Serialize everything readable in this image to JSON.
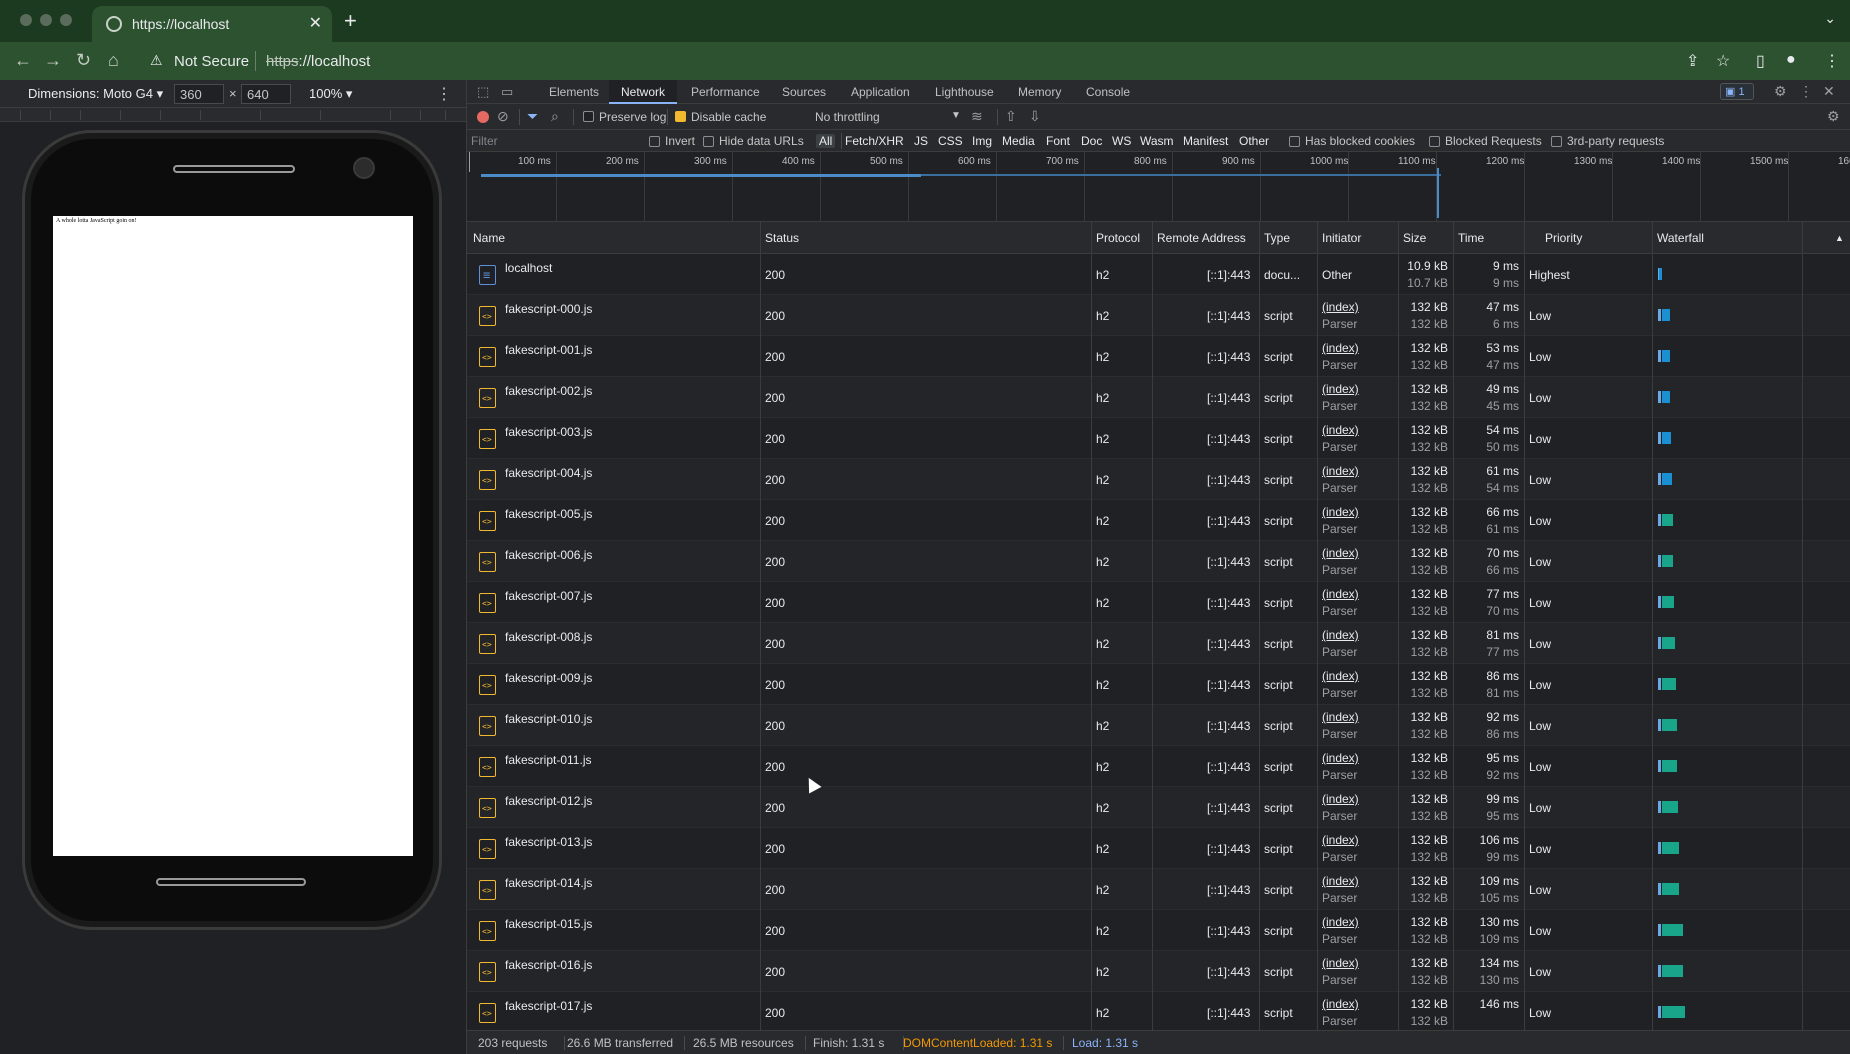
{
  "browser": {
    "tab_title": "https://localhost",
    "security_label": "Not Secure",
    "url_scheme": "https",
    "url_rest": "://localhost"
  },
  "device": {
    "dimensions_label": "Dimensions: Moto G4 ▾",
    "width": "360",
    "height": "640",
    "zoom": "100% ▾",
    "page_text": "A whole lotta JavaScript goin on!"
  },
  "devtools": {
    "tabs": [
      "Elements",
      "Network",
      "Performance",
      "Sources",
      "Application",
      "Lighthouse",
      "Memory",
      "Console"
    ],
    "active_tab": "Network",
    "issues_badge": "1"
  },
  "network_toolbar": {
    "preserve_log": "Preserve log",
    "disable_cache": "Disable cache",
    "throttling": "No throttling"
  },
  "filter_bar": {
    "placeholder": "Filter",
    "invert": "Invert",
    "hide_data_urls": "Hide data URLs",
    "types": [
      "All",
      "Fetch/XHR",
      "JS",
      "CSS",
      "Img",
      "Media",
      "Font",
      "Doc",
      "WS",
      "Wasm",
      "Manifest",
      "Other"
    ],
    "has_blocked_cookies": "Has blocked cookies",
    "blocked_requests": "Blocked Requests",
    "third_party": "3rd-party requests"
  },
  "timeline": {
    "ticks": [
      "100 ms",
      "200 ms",
      "300 ms",
      "400 ms",
      "500 ms",
      "600 ms",
      "700 ms",
      "800 ms",
      "900 ms",
      "1000 ms",
      "1100 ms",
      "1200 ms",
      "1300 ms",
      "1400 ms",
      "1500 ms",
      "160"
    ]
  },
  "columns": {
    "name": "Name",
    "status": "Status",
    "protocol": "Protocol",
    "remote": "Remote Address",
    "type": "Type",
    "initiator": "Initiator",
    "size": "Size",
    "time": "Time",
    "priority": "Priority",
    "waterfall": "Waterfall"
  },
  "requests": [
    {
      "name": "localhost",
      "status": "200",
      "protocol": "h2",
      "remote": "[::1]:443",
      "type": "docu...",
      "initiator": "Other",
      "initiator_sub": "",
      "size": "10.9 kB",
      "size_sub": "10.7 kB",
      "time": "9 ms",
      "time_sub": "9 ms",
      "priority": "Highest",
      "kind": "doc"
    },
    {
      "name": "fakescript-000.js",
      "status": "200",
      "protocol": "h2",
      "remote": "[::1]:443",
      "type": "script",
      "initiator": "(index)",
      "initiator_sub": "Parser",
      "size": "132 kB",
      "size_sub": "132 kB",
      "time": "47 ms",
      "time_sub": "6 ms",
      "priority": "Low",
      "kind": "js"
    },
    {
      "name": "fakescript-001.js",
      "status": "200",
      "protocol": "h2",
      "remote": "[::1]:443",
      "type": "script",
      "initiator": "(index)",
      "initiator_sub": "Parser",
      "size": "132 kB",
      "size_sub": "132 kB",
      "time": "53 ms",
      "time_sub": "47 ms",
      "priority": "Low",
      "kind": "js"
    },
    {
      "name": "fakescript-002.js",
      "status": "200",
      "protocol": "h2",
      "remote": "[::1]:443",
      "type": "script",
      "initiator": "(index)",
      "initiator_sub": "Parser",
      "size": "132 kB",
      "size_sub": "132 kB",
      "time": "49 ms",
      "time_sub": "45 ms",
      "priority": "Low",
      "kind": "js"
    },
    {
      "name": "fakescript-003.js",
      "status": "200",
      "protocol": "h2",
      "remote": "[::1]:443",
      "type": "script",
      "initiator": "(index)",
      "initiator_sub": "Parser",
      "size": "132 kB",
      "size_sub": "132 kB",
      "time": "54 ms",
      "time_sub": "50 ms",
      "priority": "Low",
      "kind": "js"
    },
    {
      "name": "fakescript-004.js",
      "status": "200",
      "protocol": "h2",
      "remote": "[::1]:443",
      "type": "script",
      "initiator": "(index)",
      "initiator_sub": "Parser",
      "size": "132 kB",
      "size_sub": "132 kB",
      "time": "61 ms",
      "time_sub": "54 ms",
      "priority": "Low",
      "kind": "js"
    },
    {
      "name": "fakescript-005.js",
      "status": "200",
      "protocol": "h2",
      "remote": "[::1]:443",
      "type": "script",
      "initiator": "(index)",
      "initiator_sub": "Parser",
      "size": "132 kB",
      "size_sub": "132 kB",
      "time": "66 ms",
      "time_sub": "61 ms",
      "priority": "Low",
      "kind": "js"
    },
    {
      "name": "fakescript-006.js",
      "status": "200",
      "protocol": "h2",
      "remote": "[::1]:443",
      "type": "script",
      "initiator": "(index)",
      "initiator_sub": "Parser",
      "size": "132 kB",
      "size_sub": "132 kB",
      "time": "70 ms",
      "time_sub": "66 ms",
      "priority": "Low",
      "kind": "js"
    },
    {
      "name": "fakescript-007.js",
      "status": "200",
      "protocol": "h2",
      "remote": "[::1]:443",
      "type": "script",
      "initiator": "(index)",
      "initiator_sub": "Parser",
      "size": "132 kB",
      "size_sub": "132 kB",
      "time": "77 ms",
      "time_sub": "70 ms",
      "priority": "Low",
      "kind": "js"
    },
    {
      "name": "fakescript-008.js",
      "status": "200",
      "protocol": "h2",
      "remote": "[::1]:443",
      "type": "script",
      "initiator": "(index)",
      "initiator_sub": "Parser",
      "size": "132 kB",
      "size_sub": "132 kB",
      "time": "81 ms",
      "time_sub": "77 ms",
      "priority": "Low",
      "kind": "js"
    },
    {
      "name": "fakescript-009.js",
      "status": "200",
      "protocol": "h2",
      "remote": "[::1]:443",
      "type": "script",
      "initiator": "(index)",
      "initiator_sub": "Parser",
      "size": "132 kB",
      "size_sub": "132 kB",
      "time": "86 ms",
      "time_sub": "81 ms",
      "priority": "Low",
      "kind": "js"
    },
    {
      "name": "fakescript-010.js",
      "status": "200",
      "protocol": "h2",
      "remote": "[::1]:443",
      "type": "script",
      "initiator": "(index)",
      "initiator_sub": "Parser",
      "size": "132 kB",
      "size_sub": "132 kB",
      "time": "92 ms",
      "time_sub": "86 ms",
      "priority": "Low",
      "kind": "js"
    },
    {
      "name": "fakescript-011.js",
      "status": "200",
      "protocol": "h2",
      "remote": "[::1]:443",
      "type": "script",
      "initiator": "(index)",
      "initiator_sub": "Parser",
      "size": "132 kB",
      "size_sub": "132 kB",
      "time": "95 ms",
      "time_sub": "92 ms",
      "priority": "Low",
      "kind": "js"
    },
    {
      "name": "fakescript-012.js",
      "status": "200",
      "protocol": "h2",
      "remote": "[::1]:443",
      "type": "script",
      "initiator": "(index)",
      "initiator_sub": "Parser",
      "size": "132 kB",
      "size_sub": "132 kB",
      "time": "99 ms",
      "time_sub": "95 ms",
      "priority": "Low",
      "kind": "js"
    },
    {
      "name": "fakescript-013.js",
      "status": "200",
      "protocol": "h2",
      "remote": "[::1]:443",
      "type": "script",
      "initiator": "(index)",
      "initiator_sub": "Parser",
      "size": "132 kB",
      "size_sub": "132 kB",
      "time": "106 ms",
      "time_sub": "99 ms",
      "priority": "Low",
      "kind": "js"
    },
    {
      "name": "fakescript-014.js",
      "status": "200",
      "protocol": "h2",
      "remote": "[::1]:443",
      "type": "script",
      "initiator": "(index)",
      "initiator_sub": "Parser",
      "size": "132 kB",
      "size_sub": "132 kB",
      "time": "109 ms",
      "time_sub": "105 ms",
      "priority": "Low",
      "kind": "js"
    },
    {
      "name": "fakescript-015.js",
      "status": "200",
      "protocol": "h2",
      "remote": "[::1]:443",
      "type": "script",
      "initiator": "(index)",
      "initiator_sub": "Parser",
      "size": "132 kB",
      "size_sub": "132 kB",
      "time": "130 ms",
      "time_sub": "109 ms",
      "priority": "Low",
      "kind": "js"
    },
    {
      "name": "fakescript-016.js",
      "status": "200",
      "protocol": "h2",
      "remote": "[::1]:443",
      "type": "script",
      "initiator": "(index)",
      "initiator_sub": "Parser",
      "size": "132 kB",
      "size_sub": "132 kB",
      "time": "134 ms",
      "time_sub": "130 ms",
      "priority": "Low",
      "kind": "js"
    },
    {
      "name": "fakescript-017.js",
      "status": "200",
      "protocol": "h2",
      "remote": "[::1]:443",
      "type": "script",
      "initiator": "(index)",
      "initiator_sub": "Parser",
      "size": "132 kB",
      "size_sub": "132 kB",
      "time": "146 ms",
      "time_sub": "",
      "priority": "Low",
      "kind": "js"
    }
  ],
  "status_bar": {
    "requests": "203 requests",
    "transferred": "26.6 MB transferred",
    "resources": "26.5 MB resources",
    "finish": "Finish: 1.31 s",
    "dcl": "DOMContentLoaded: 1.31 s",
    "load": "Load: 1.31 s"
  },
  "colors": {
    "chrome_frame": "#1c3a1f",
    "toolbar": "#2d5230",
    "devtools_bg": "#202124",
    "waterfall_receive": "#19a589",
    "dcl": "#f29900",
    "load": "#8ab4f8"
  }
}
